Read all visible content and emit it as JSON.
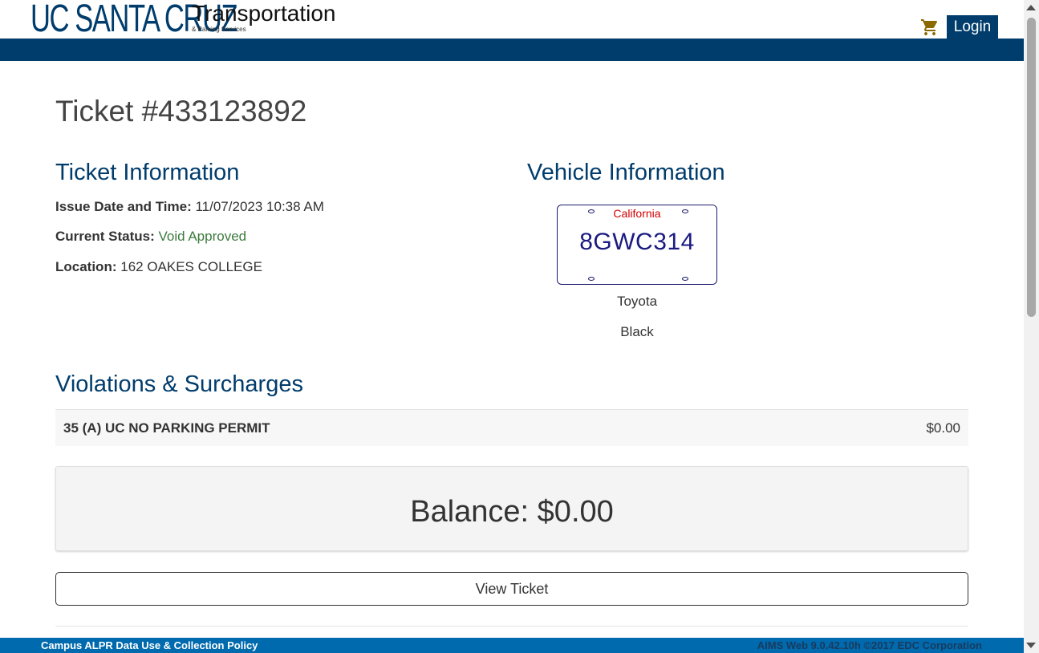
{
  "header": {
    "logo_main": "UC SANTA CRUZ",
    "logo_title": "Transportation",
    "logo_subtitle": "& Parking Services",
    "cart_icon": "shopping-cart-icon",
    "login_label": "Login"
  },
  "ticket": {
    "title": "Ticket #433123892"
  },
  "ticket_info": {
    "heading": "Ticket Information",
    "issue_label": "Issue Date and Time:",
    "issue_value": "11/07/2023 10:38 AM",
    "status_label": "Current Status:",
    "status_value": "Void Approved",
    "location_label": "Location:",
    "location_value": "162 OAKES COLLEGE"
  },
  "vehicle_info": {
    "heading": "Vehicle Information",
    "plate_state": "California",
    "plate_number": "8GWC314",
    "make": "Toyota",
    "color": "Black"
  },
  "violations": {
    "heading": "Violations & Surcharges",
    "items": [
      {
        "name": "35 (A) UC NO PARKING PERMIT",
        "amount": "$0.00"
      }
    ]
  },
  "balance": {
    "label": "Balance: $0.00"
  },
  "actions": {
    "view_ticket_label": "View Ticket"
  },
  "footer": {
    "policy_link": "Campus ALPR Data Use & Collection Policy",
    "copyright": "AIMS Web 9.0.42.10h ©2017 EDC Corporation"
  },
  "colors": {
    "brand_navy": "#003c6c",
    "footer_blue": "#006aae",
    "status_green": "#3c7a3c",
    "plate_red": "#d40000",
    "cart_gold": "#8a6a00"
  }
}
